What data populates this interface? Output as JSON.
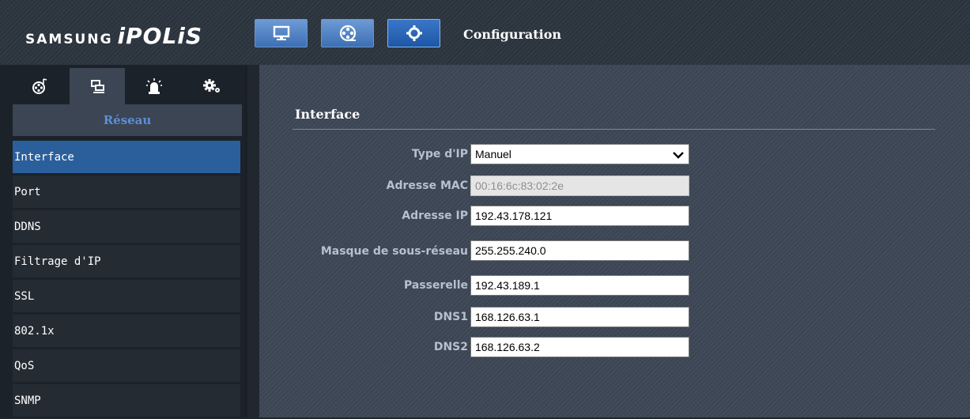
{
  "header": {
    "brand": "SAMSUNG",
    "product": "iPOLiS",
    "title": "Configuration",
    "buttons": [
      {
        "icon": "monitor-icon"
      },
      {
        "icon": "film-reel-icon"
      },
      {
        "icon": "gear-icon"
      }
    ]
  },
  "sidebar": {
    "tabs": [
      {
        "icon": "video-setup-icon"
      },
      {
        "icon": "network-icon"
      },
      {
        "icon": "alarm-icon"
      },
      {
        "icon": "system-settings-icon"
      }
    ],
    "section_title": "Réseau",
    "items": [
      {
        "label": "Interface",
        "active": true
      },
      {
        "label": "Port"
      },
      {
        "label": "DDNS"
      },
      {
        "label": "Filtrage d'IP"
      },
      {
        "label": "SSL"
      },
      {
        "label": "802.1x"
      },
      {
        "label": "QoS"
      },
      {
        "label": "SNMP"
      }
    ]
  },
  "main": {
    "title": "Interface",
    "fields": {
      "ip_type": {
        "label": "Type d'IP",
        "value": "Manuel"
      },
      "mac": {
        "label": "Adresse MAC",
        "value": "00:16:6c:83:02:2e"
      },
      "ip": {
        "label": "Adresse IP",
        "value": "192.43.178.121"
      },
      "mask": {
        "label": "Masque de sous-réseau",
        "value": "255.255.240.0"
      },
      "gateway": {
        "label": "Passerelle",
        "value": "192.43.189.1"
      },
      "dns1": {
        "label": "DNS1",
        "value": "168.126.63.1"
      },
      "dns2": {
        "label": "DNS2",
        "value": "168.126.63.2"
      }
    }
  }
}
